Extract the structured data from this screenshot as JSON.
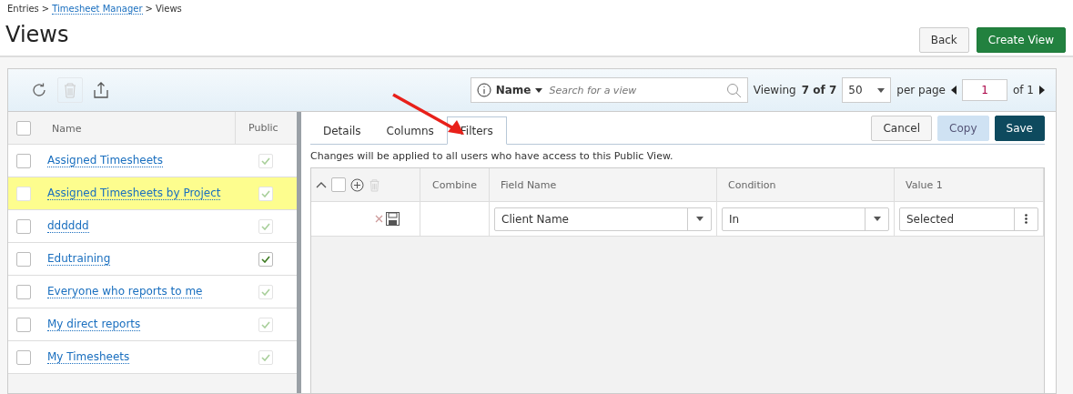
{
  "breadcrumbs": [
    {
      "label": "Entries",
      "link": false
    },
    {
      "label": "Timesheet Manager",
      "link": true
    },
    {
      "label": "Views",
      "link": false
    }
  ],
  "breadcrumb_separator": ">",
  "title": "Views",
  "header_buttons": [
    {
      "label": "Back",
      "kind": "default"
    },
    {
      "label": "Create View",
      "kind": "primary"
    }
  ],
  "toolbar": {
    "search_field": "Name",
    "search_placeholder": "Search for a view",
    "viewing": "Viewing",
    "viewing_count": "7 of 7",
    "per_page_value": "50",
    "per_page": "per page",
    "page": "1",
    "page_of": "of 1"
  },
  "list": {
    "columns": [
      "Name",
      "Public"
    ],
    "all_checked": false,
    "rows": [
      {
        "name": "Assigned Timesheets",
        "public": true,
        "public_disabled": true,
        "highlighted": false
      },
      {
        "name": "Assigned Timesheets by Project",
        "public": true,
        "public_disabled": true,
        "highlighted": true
      },
      {
        "name": "dddddd",
        "public": true,
        "public_disabled": true,
        "highlighted": false
      },
      {
        "name": "Edutraining",
        "public": true,
        "public_disabled": false,
        "highlighted": false
      },
      {
        "name": "Everyone who reports to me",
        "public": true,
        "public_disabled": true,
        "highlighted": false
      },
      {
        "name": "My direct reports",
        "public": true,
        "public_disabled": true,
        "highlighted": false
      },
      {
        "name": "My Timesheets",
        "public": true,
        "public_disabled": true,
        "highlighted": false
      }
    ]
  },
  "tabs": [
    {
      "label": "Details",
      "selected": false
    },
    {
      "label": "Columns",
      "selected": false
    },
    {
      "label": "Filters",
      "selected": true
    }
  ],
  "actions": [
    {
      "label": "Cancel",
      "kind": "default"
    },
    {
      "label": "Copy",
      "kind": "disabled"
    },
    {
      "label": "Save",
      "kind": "primary"
    }
  ],
  "notice": "Changes will be applied to all users who have access to this Public View.",
  "filters": {
    "all_checked": false,
    "columns": [
      "Combine",
      "Field Name",
      "Condition",
      "Value 1"
    ],
    "rows": [
      {
        "field": "Client Name",
        "condition": "In",
        "value": "Selected"
      }
    ]
  }
}
